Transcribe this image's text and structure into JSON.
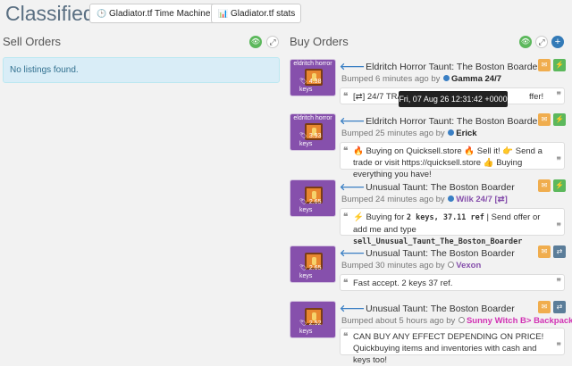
{
  "header": {
    "title": "Classifieds",
    "btn_time_machine": "Gladiator.tf Time Machine",
    "btn_stats": "Gladiator.tf stats"
  },
  "sell": {
    "title": "Sell Orders",
    "empty": "No listings found."
  },
  "buy": {
    "title": "Buy Orders"
  },
  "tooltip": "Fri, 07 Aug 26 12:31:42 +0000",
  "listings": [
    {
      "title": "Eldritch Horror Taunt: The Boston Boarder",
      "badge": "eldritch horror",
      "price": "4.38 keys",
      "bumped": "Bumped 6 minutes ago by",
      "user": "Gamma 24/7",
      "quote_a": "[⇄] 24/7 TRA",
      "quote_b": "ffer!"
    },
    {
      "title": "Eldritch Horror Taunt: The Boston Boarder",
      "badge": "eldritch horror",
      "price": "3.93 keys",
      "bumped": "Bumped 25 minutes ago by",
      "user": "Erick",
      "quote": "🔥 Buying on Quicksell.store 🔥 Sell it! 👉 Send a trade or visit https://quicksell.store 👍 Buying everything you have!"
    },
    {
      "title": "Unusual Taunt: The Boston Boarder",
      "price": "2.65 keys",
      "bumped": "Bumped 24 minutes ago by",
      "user": "Wilk 24/7 [⇄]",
      "quote_pre": "⚡ Buying for ",
      "quote_price": "2 keys, 37.11 ref",
      "quote_mid": " | Send offer or add me and type ",
      "quote_cmd": "sell_Unusual_Taunt_The_Boston_Boarder"
    },
    {
      "title": "Unusual Taunt: The Boston Boarder",
      "price": "2.65 keys",
      "bumped": "Bumped 30 minutes ago by",
      "user": "Vexon",
      "quote": "Fast accept. 2 keys 37 ref."
    },
    {
      "title": "Unusual Taunt: The Boston Boarder",
      "price": "2.52 keys",
      "bumped": "Bumped about 5 hours ago by",
      "user": "Sunny Witch B> Backpacks!",
      "quote": "CAN BUY ANY EFFECT DEPENDING ON PRICE! Quickbuying items and inventories with cash and keys too!"
    }
  ],
  "colors": {
    "unusual": "#8650ac",
    "eldritch": "#8650ac",
    "green": "#5cb85c",
    "orange": "#f0ad4e",
    "blue": "#3a7fc4",
    "user_purple": "#8650ac",
    "user_pink": "#d232b4"
  }
}
